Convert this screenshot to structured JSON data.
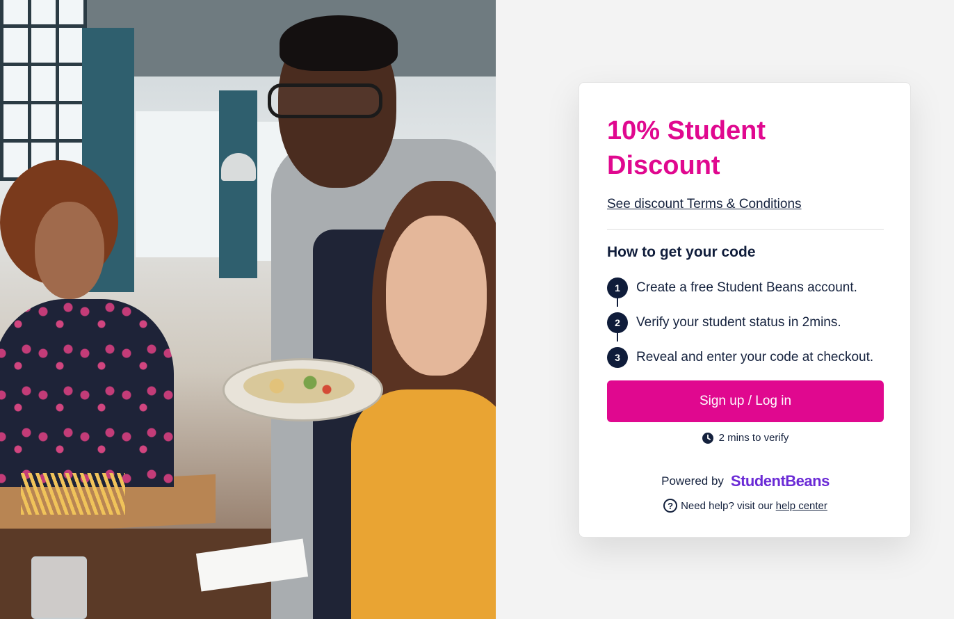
{
  "hero": {
    "image": "students-dining-restaurant-photo"
  },
  "card": {
    "title": "10% Student Discount",
    "terms_link": "See discount Terms & Conditions",
    "howto_heading": "How to get your code",
    "steps": [
      {
        "number": "1",
        "text": "Create a free Student Beans account."
      },
      {
        "number": "2",
        "text": "Verify your student status in 2mins."
      },
      {
        "number": "3",
        "text": "Reveal and enter your code at checkout."
      }
    ],
    "cta_label": "Sign up / Log in",
    "verify_text": "2 mins to verify",
    "powered_by": "Powered by",
    "brand_name": "StudentBeans",
    "help_text": "Need help? visit our",
    "help_link": "help center"
  },
  "icons": {
    "clock": "clock-icon",
    "help": "question-circle-icon"
  },
  "colors": {
    "accent": "#e0088f",
    "brand_purple": "#6b2bd6",
    "text_dark": "#14213d",
    "background": "#f3f3f3"
  }
}
